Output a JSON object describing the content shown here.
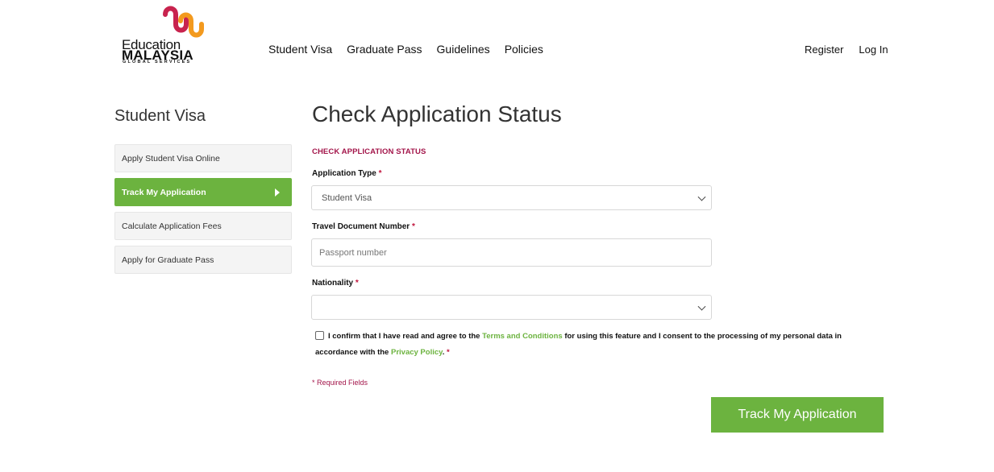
{
  "brand": {
    "line1": "Education",
    "line2": "MALAYSIA",
    "line3": "GLOBAL SERVICES",
    "colors": {
      "red": "#c8234e",
      "orange": "#f39a1e"
    }
  },
  "nav": {
    "items": [
      "Student Visa",
      "Graduate Pass",
      "Guidelines",
      "Policies"
    ],
    "register": "Register",
    "login": "Log In"
  },
  "sidebar": {
    "title": "Student Visa",
    "items": [
      {
        "label": "Apply Student Visa Online",
        "active": false
      },
      {
        "label": "Track My Application",
        "active": true
      },
      {
        "label": "Calculate Application Fees",
        "active": false
      },
      {
        "label": "Apply for Graduate Pass",
        "active": false
      }
    ]
  },
  "main": {
    "title": "Check Application Status",
    "section_label": "CHECK APPLICATION STATUS",
    "fields": {
      "application_type": {
        "label": "Application Type",
        "value": "Student Visa"
      },
      "travel_document": {
        "label": "Travel Document Number",
        "placeholder": "Passport number"
      },
      "nationality": {
        "label": "Nationality",
        "value": ""
      }
    },
    "required_marker": "*",
    "consent": {
      "text1": "I confirm that I have read and agree to the ",
      "link1": "Terms and Conditions",
      "text2": " for using this feature and I consent to the processing of my personal data in accordance with the ",
      "link2": "Privacy Policy",
      "text3": ". "
    },
    "required_note": "* Required Fields",
    "submit_label": "Track My Application"
  },
  "theme": {
    "accent": "#6cb33f",
    "maroon": "#a3154a"
  }
}
